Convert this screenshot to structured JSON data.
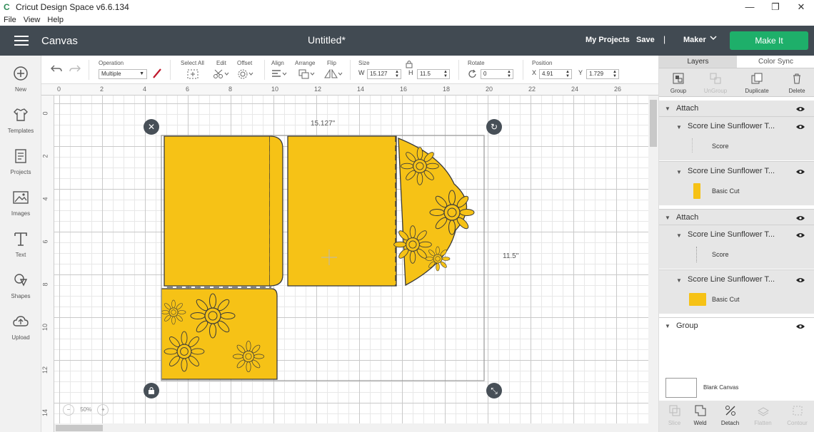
{
  "window": {
    "app_title": "Cricut Design Space  v6.6.134",
    "minimize": "—",
    "maximize": "❐",
    "close": "✕"
  },
  "menu": {
    "items": [
      "File",
      "View",
      "Help"
    ]
  },
  "header": {
    "section": "Canvas",
    "doc_title": "Untitled*",
    "my_projects": "My Projects",
    "save": "Save",
    "separator": "|",
    "machine": "Maker",
    "make_it": "Make It",
    "make_it_color": "#1eaf6a"
  },
  "left_tools": [
    {
      "label": "New",
      "icon": "plus-circle-icon"
    },
    {
      "label": "Templates",
      "icon": "tshirt-icon"
    },
    {
      "label": "Projects",
      "icon": "projects-icon"
    },
    {
      "label": "Images",
      "icon": "image-icon"
    },
    {
      "label": "Text",
      "icon": "text-t-icon"
    },
    {
      "label": "Shapes",
      "icon": "shapes-icon"
    },
    {
      "label": "Upload",
      "icon": "cloud-upload-icon"
    }
  ],
  "toolbar": {
    "operation_label": "Operation",
    "operation_value": "Multiple",
    "select_all": "Select All",
    "edit": "Edit",
    "offset": "Offset",
    "align": "Align",
    "arrange": "Arrange",
    "flip": "Flip",
    "size": "Size",
    "w_label": "W",
    "w_value": "15.127",
    "h_label": "H",
    "h_value": "11.5",
    "rotate": "Rotate",
    "rotate_value": "0",
    "position": "Position",
    "x_label": "X",
    "x_value": "4.91",
    "y_label": "Y",
    "y_value": "1.729"
  },
  "ruler": {
    "top": [
      "0",
      "2",
      "4",
      "6",
      "8",
      "10",
      "12",
      "14",
      "16",
      "18",
      "20",
      "22",
      "24",
      "26"
    ],
    "left": [
      "0",
      "2",
      "4",
      "6",
      "8",
      "10",
      "12",
      "14"
    ]
  },
  "canvas": {
    "width_label": "15.127\"",
    "height_label": "11.5\"",
    "zoom_value": "50%",
    "fill_color": "#f6c216",
    "outline_color": "#3a3a3a"
  },
  "right_panel": {
    "tabs": [
      "Layers",
      "Color Sync"
    ],
    "actions": [
      {
        "label": "Group",
        "disabled": false
      },
      {
        "label": "UnGroup",
        "disabled": true
      },
      {
        "label": "Duplicate",
        "disabled": false
      },
      {
        "label": "Delete",
        "disabled": false
      }
    ],
    "layers": {
      "attach1": "Attach",
      "item1": "Score Line Sunflower T...",
      "item1_sub": "Score",
      "item2": "Score Line Sunflower T...",
      "item2_sub": "Basic Cut",
      "attach2": "Attach",
      "item3": "Score Line Sunflower T...",
      "item3_sub": "Score",
      "item4": "Score Line Sunflower T...",
      "item4_sub": "Basic Cut",
      "group": "Group"
    },
    "blank_canvas": "Blank Canvas",
    "bottom_actions": [
      {
        "label": "Slice",
        "disabled": true
      },
      {
        "label": "Weld",
        "disabled": false
      },
      {
        "label": "Detach",
        "disabled": false
      },
      {
        "label": "Flatten",
        "disabled": true
      },
      {
        "label": "Contour",
        "disabled": true
      }
    ]
  }
}
